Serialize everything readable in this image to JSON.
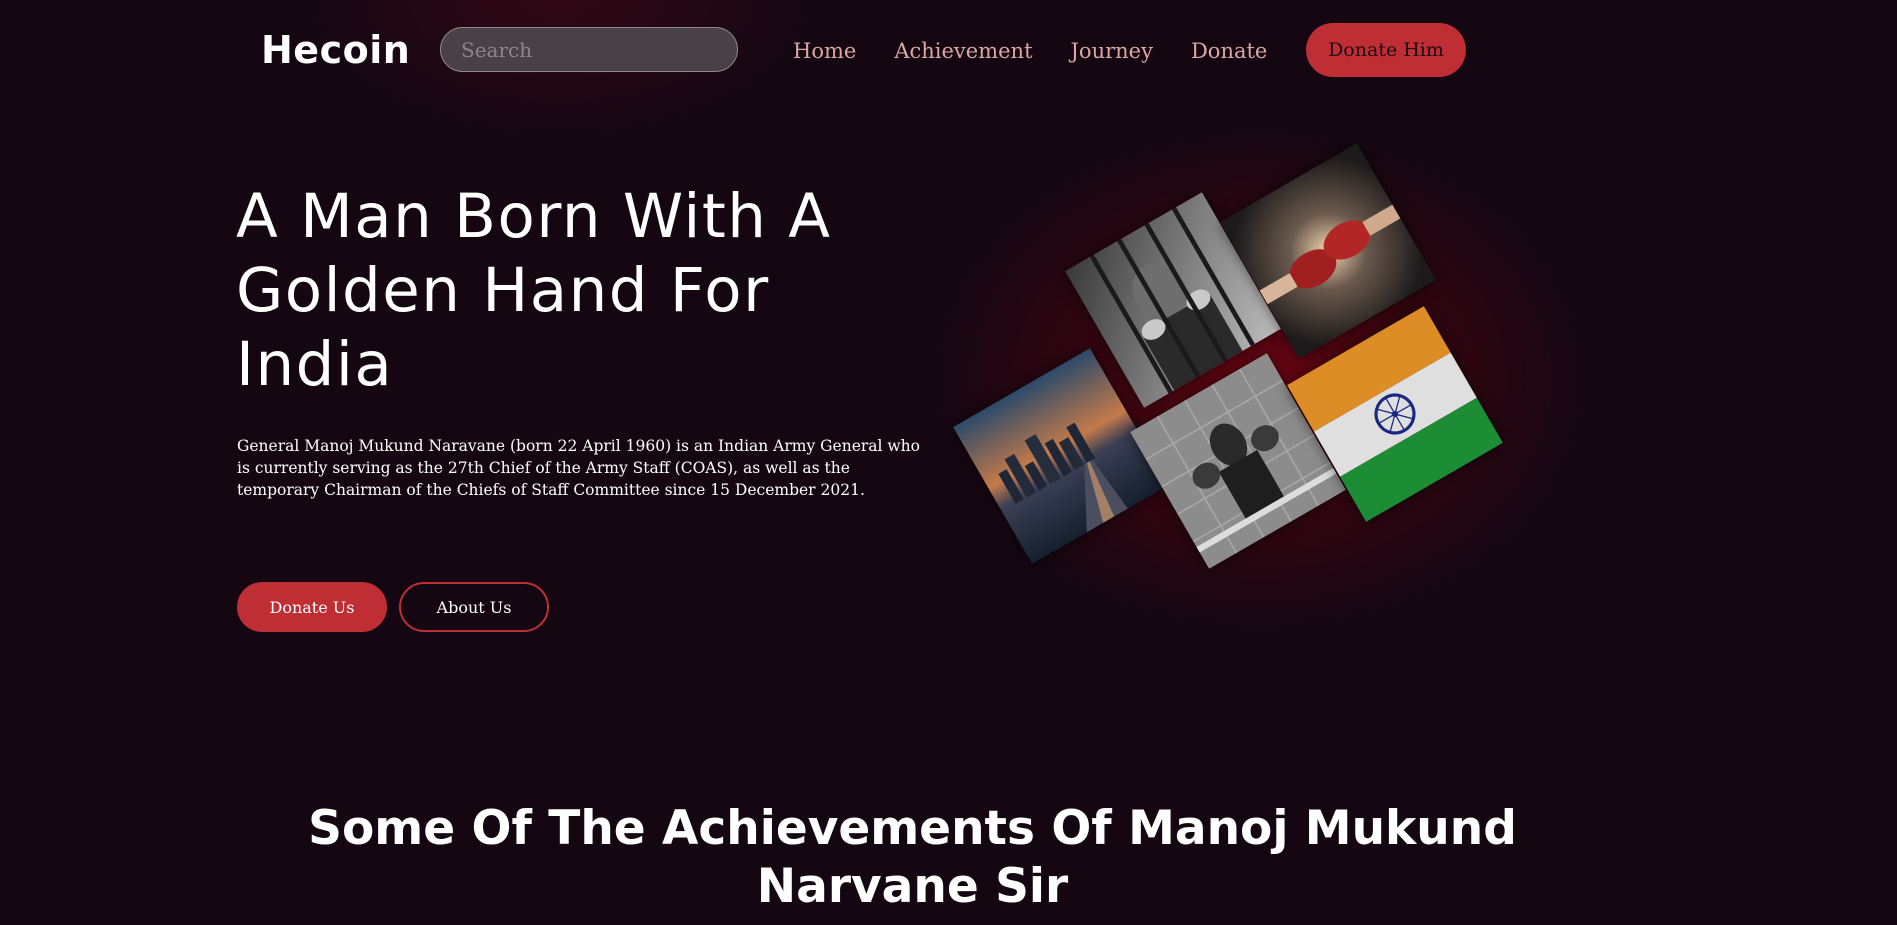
{
  "brand": {
    "name": "Hecoin",
    "accent": "#be2e34",
    "background": "#140712"
  },
  "search": {
    "placeholder": "Search",
    "value": ""
  },
  "nav": {
    "links": [
      {
        "label": "Home"
      },
      {
        "label": "Achievement"
      },
      {
        "label": "Journey"
      },
      {
        "label": "Donate"
      }
    ],
    "cta_label": "Donate Him"
  },
  "hero": {
    "title": "A Man Born With A Golden Hand For India",
    "description": "General Manoj Mukund Naravane (born 22 April 1960) is an Indian Army General who is currently serving as the 27th Chief of the Army Staff (COAS), as well as the temporary Chairman of the Chiefs of Staff Committee since 15 December 2021.",
    "primary_button": "Donate Us",
    "secondary_button": "About Us"
  },
  "collage": {
    "images": [
      {
        "name": "prisoner-behind-bars-image"
      },
      {
        "name": "boxing-gloves-clash-image"
      },
      {
        "name": "city-skyline-sunset-image"
      },
      {
        "name": "boxer-in-ring-image"
      },
      {
        "name": "indian-flag-image"
      }
    ]
  },
  "achievements": {
    "title": "Some Of The Achievements Of Manoj Mukund Narvane Sir"
  }
}
